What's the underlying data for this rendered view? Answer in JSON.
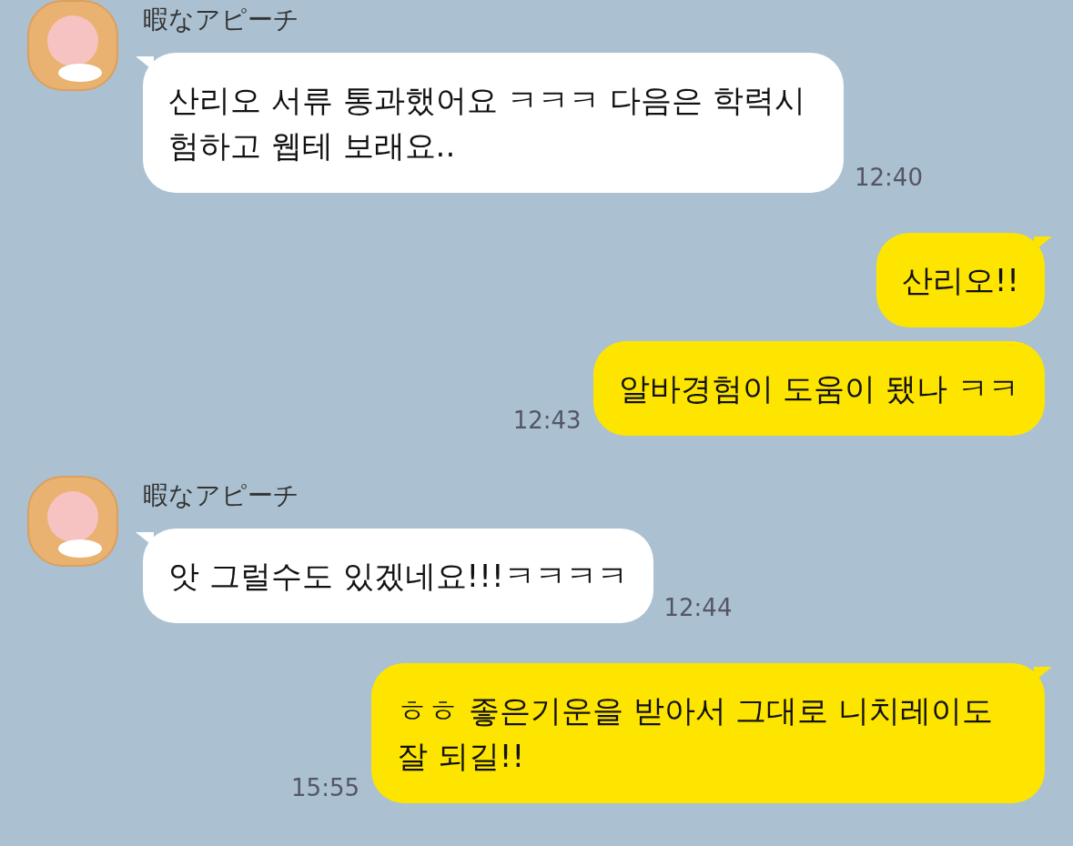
{
  "messages": [
    {
      "kind": "incoming",
      "sender": "暇なアピーチ",
      "text": "산리오 서류 통과했어요 ㅋㅋㅋ 다음은 학력시험하고 웹테 보래요..",
      "time": "12:40"
    },
    {
      "kind": "outgoing",
      "text": "산리오!!",
      "tail": true
    },
    {
      "kind": "outgoing",
      "text": "알바경험이 도움이 됐나 ㅋㅋ",
      "time": "12:43",
      "tail": false
    },
    {
      "kind": "incoming",
      "sender": "暇なアピーチ",
      "text": "앗 그럴수도 있겠네요!!!ㅋㅋㅋㅋ",
      "time": "12:44"
    },
    {
      "kind": "outgoing",
      "text": "ㅎㅎ 좋은기운을 받아서 그대로 니치레이도 잘 되길!!",
      "time": "15:55",
      "tail": true
    }
  ]
}
